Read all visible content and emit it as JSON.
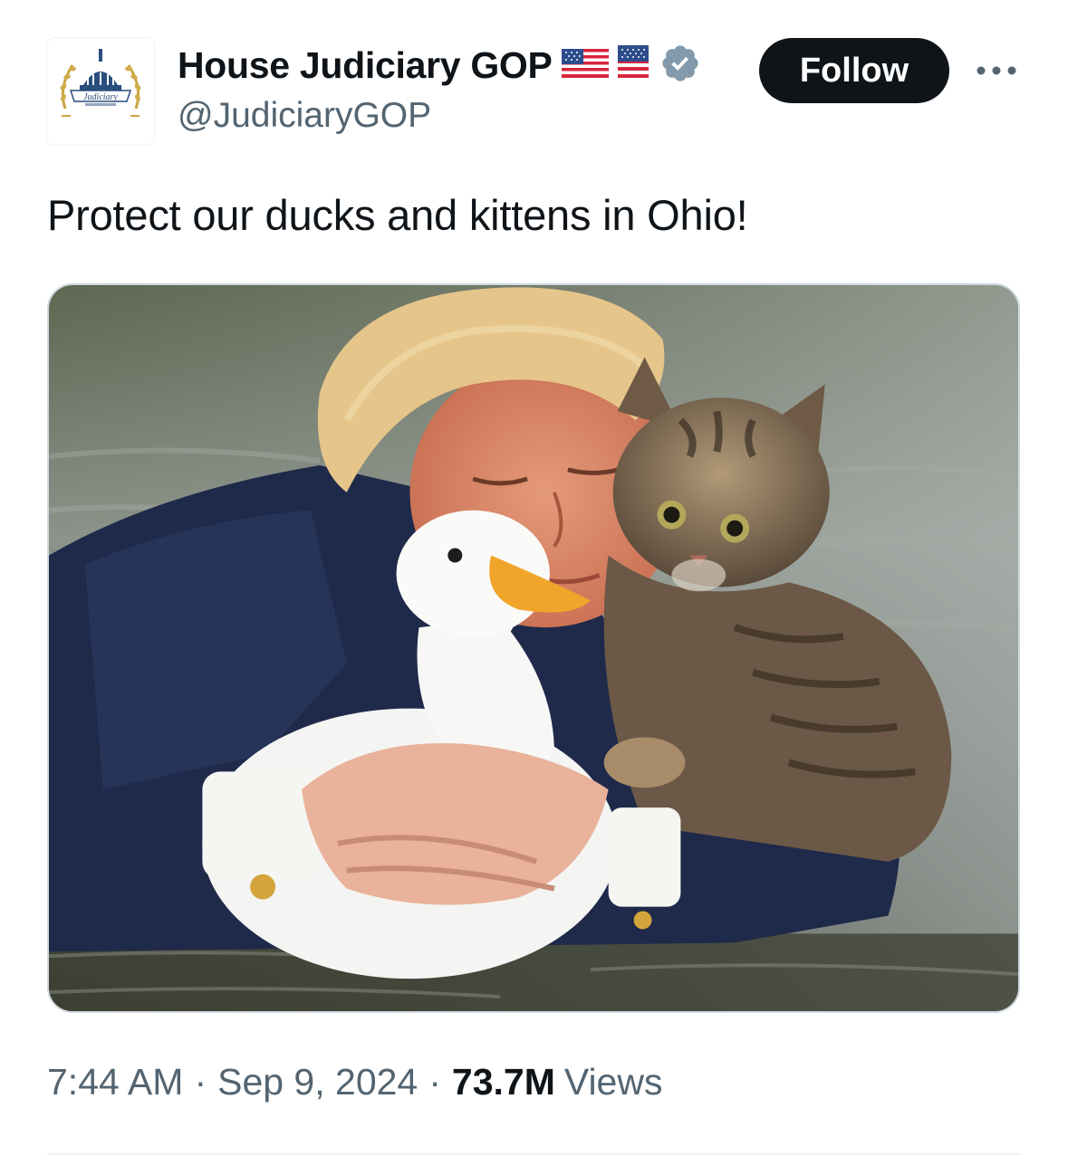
{
  "account": {
    "display_name": "House Judiciary GOP",
    "handle": "@JudiciaryGOP",
    "avatar_text": "Judiciary",
    "verified": true,
    "badges": [
      "us-flag-icon",
      "us-flag-icon",
      "verified-badge-icon"
    ]
  },
  "actions": {
    "follow_label": "Follow",
    "more_icon": "more-horizontal-icon"
  },
  "tweet": {
    "text": "Protect our ducks and kittens in Ohio!",
    "image_alt": "Man in a dark suit hugging a white duck and a tabby kitten while standing in water"
  },
  "meta": {
    "time": "7:44 AM",
    "separator_1": "·",
    "date": "Sep 9, 2024",
    "separator_2": "·",
    "views_count": "73.7M",
    "views_label": "Views"
  },
  "colors": {
    "text_primary": "#0f1419",
    "text_secondary": "#536471",
    "follow_bg": "#0f1419",
    "verified": "#829aab",
    "border": "#cfd9de"
  }
}
